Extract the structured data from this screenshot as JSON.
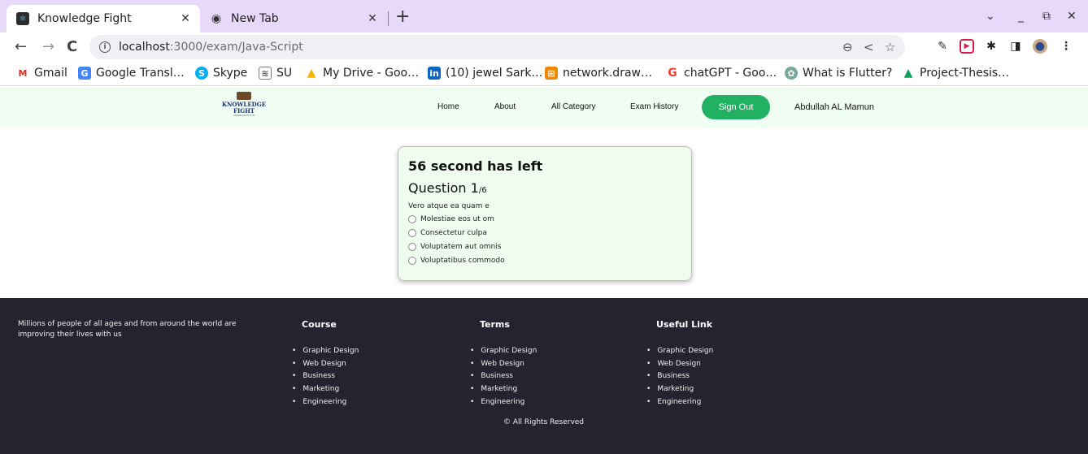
{
  "browser": {
    "tabs": [
      {
        "title": "Knowledge Fight",
        "active": true
      },
      {
        "title": "New Tab",
        "active": false
      }
    ],
    "url_host": "localhost",
    "url_path": ":3000/exam/Java-Script",
    "bookmarks": [
      {
        "label": "Gmail",
        "icon": "gmail-icon"
      },
      {
        "label": "Google Transl…",
        "icon": "google-translate-icon"
      },
      {
        "label": "Skype",
        "icon": "skype-icon"
      },
      {
        "label": "SU",
        "icon": "su-icon"
      },
      {
        "label": "My Drive - Goo…",
        "icon": "google-drive-icon"
      },
      {
        "label": "(10) jewel Sark…",
        "icon": "linkedin-icon"
      },
      {
        "label": "network.draw…",
        "icon": "drawio-icon"
      },
      {
        "label": "chatGPT - Goo…",
        "icon": "google-icon"
      },
      {
        "label": "What is Flutter?",
        "icon": "chatgpt-icon"
      },
      {
        "label": "Project-Thesis…",
        "icon": "google-drive-icon"
      }
    ]
  },
  "site": {
    "logo": {
      "line1": "KNOWLEDGE",
      "line2": "FIGHT",
      "line3": "LEARN WITH FUN"
    },
    "nav": [
      "Home",
      "About",
      "All Category",
      "Exam History"
    ],
    "signout_label": "Sign Out",
    "username": "Abdullah AL Mamun",
    "accent_color": "#22b062"
  },
  "exam": {
    "timer_text": "56 second has left",
    "question_label": "Question 1",
    "question_total": "/6",
    "question_text": "Vero atque ea quam e",
    "options": [
      "Molestiae eos ut om",
      "Consectetur culpa",
      "Voluptatem aut omnis",
      "Voluptatibus commodo"
    ]
  },
  "footer": {
    "about": "Millions of people of all ages and from around the world are improving their lives with us",
    "columns": [
      {
        "title": "Course",
        "items": [
          "Graphic Design",
          "Web Design",
          "Business",
          "Marketing",
          "Engineering"
        ]
      },
      {
        "title": "Terms",
        "items": [
          "Graphic Design",
          "Web Design",
          "Business",
          "Marketing",
          "Engineering"
        ]
      },
      {
        "title": "Useful Link",
        "items": [
          "Graphic Design",
          "Web Design",
          "Business",
          "Marketing",
          "Engineering"
        ]
      }
    ],
    "copyright": "© All Rights Reserved"
  }
}
